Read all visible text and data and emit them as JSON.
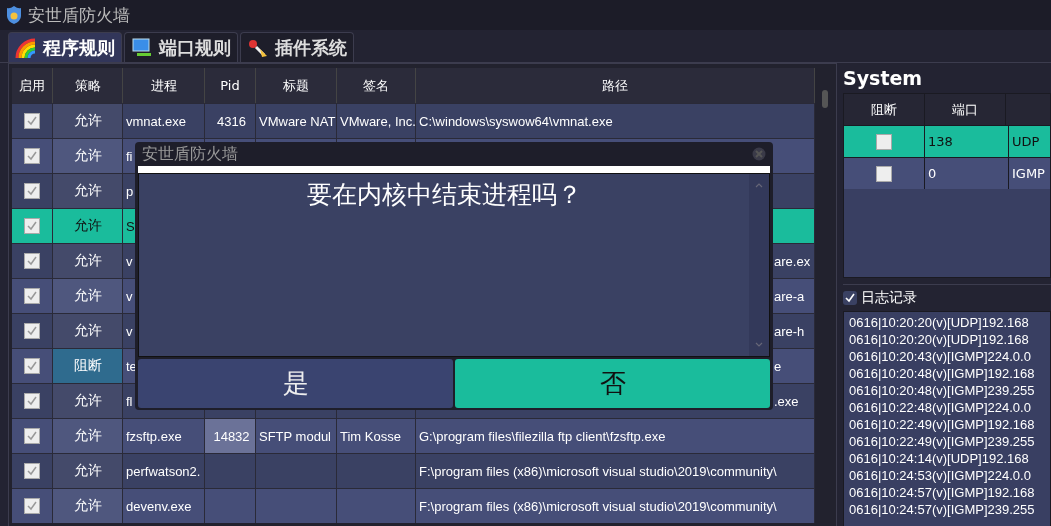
{
  "window": {
    "title": "安世盾防火墙"
  },
  "tabs": [
    {
      "label": "程序规则",
      "selected": true
    },
    {
      "label": "端口规则",
      "selected": false
    },
    {
      "label": "插件系统",
      "selected": false
    }
  ],
  "rules_table": {
    "columns": [
      "启用",
      "策略",
      "进程",
      "Pid",
      "标题",
      "签名",
      "路径"
    ],
    "rows": [
      {
        "enabled": true,
        "policy": "允许",
        "blocked": false,
        "process": "vmnat.exe",
        "pid": "4316",
        "title": "VMware NAT",
        "signer": "VMware, Inc.",
        "path": "C:\\windows\\syswow64\\vmnat.exe",
        "selected": false,
        "pid_highlighted": false
      },
      {
        "enabled": true,
        "policy": "允许",
        "blocked": false,
        "process": "fi",
        "selected": false,
        "pid_highlighted": false
      },
      {
        "enabled": true,
        "policy": "允许",
        "blocked": false,
        "process": "p",
        "selected": false,
        "pid_highlighted": false
      },
      {
        "enabled": true,
        "policy": "允许",
        "blocked": false,
        "process": "S",
        "selected": true,
        "pid_highlighted": false
      },
      {
        "enabled": true,
        "policy": "允许",
        "blocked": false,
        "process": "v",
        "path": "are.ex",
        "selected": false,
        "pid_highlighted": false
      },
      {
        "enabled": true,
        "policy": "允许",
        "blocked": false,
        "process": "v",
        "path": "are-a",
        "selected": false,
        "pid_highlighted": false
      },
      {
        "enabled": true,
        "policy": "允许",
        "blocked": false,
        "process": "v",
        "path": "are-h",
        "selected": false,
        "pid_highlighted": false
      },
      {
        "enabled": true,
        "policy": "阻断",
        "blocked": true,
        "process": "te",
        "path": "e",
        "selected": false,
        "pid_highlighted": false
      },
      {
        "enabled": true,
        "policy": "允许",
        "blocked": false,
        "process": "fl",
        "path": ".exe",
        "selected": false,
        "pid_highlighted": false
      },
      {
        "enabled": true,
        "policy": "允许",
        "blocked": false,
        "process": "fzsftp.exe",
        "pid": "14832",
        "title": "SFTP modul",
        "signer": "Tim Kosse",
        "path": "G:\\program files\\filezilla ftp client\\fzsftp.exe",
        "selected": false,
        "pid_highlighted": true
      },
      {
        "enabled": true,
        "policy": "允许",
        "blocked": false,
        "process": "perfwatson2.",
        "path": "F:\\program files (x86)\\microsoft visual studio\\2019\\community\\",
        "selected": false,
        "pid_highlighted": false
      },
      {
        "enabled": true,
        "policy": "允许",
        "blocked": false,
        "process": "devenv.exe",
        "path": "F:\\program files (x86)\\microsoft visual studio\\2019\\community\\",
        "selected": false,
        "pid_highlighted": false
      }
    ]
  },
  "system_panel": {
    "title": "System",
    "columns": [
      "阻断",
      "端口"
    ],
    "rows": [
      {
        "blocked": false,
        "port": "138",
        "protocol": "UDP",
        "selected": true
      },
      {
        "blocked": false,
        "port": "0",
        "protocol": "IGMP",
        "selected": false
      }
    ]
  },
  "log": {
    "label": "日志记录",
    "checked": true,
    "lines": [
      "0616|10:20:20(v)[UDP]192.168",
      "0616|10:20:20(v)[UDP]192.168",
      "0616|10:20:43(v)[IGMP]224.0.0",
      "0616|10:20:48(v)[IGMP]192.168",
      "0616|10:20:48(v)[IGMP]239.255",
      "0616|10:22:48(v)[IGMP]224.0.0",
      "0616|10:22:49(v)[IGMP]192.168",
      "0616|10:22:49(v)[IGMP]239.255",
      "0616|10:24:14(v)[UDP]192.168",
      "0616|10:24:53(v)[IGMP]224.0.0",
      "0616|10:24:57(v)[IGMP]192.168",
      "0616|10:24:57(v)[IGMP]239.255"
    ]
  },
  "dialog": {
    "title": "安世盾防火墙",
    "message": "要在内核中结束进程吗？",
    "buttons": [
      {
        "label": "是",
        "selected": false
      },
      {
        "label": "否",
        "selected": true
      }
    ]
  }
}
